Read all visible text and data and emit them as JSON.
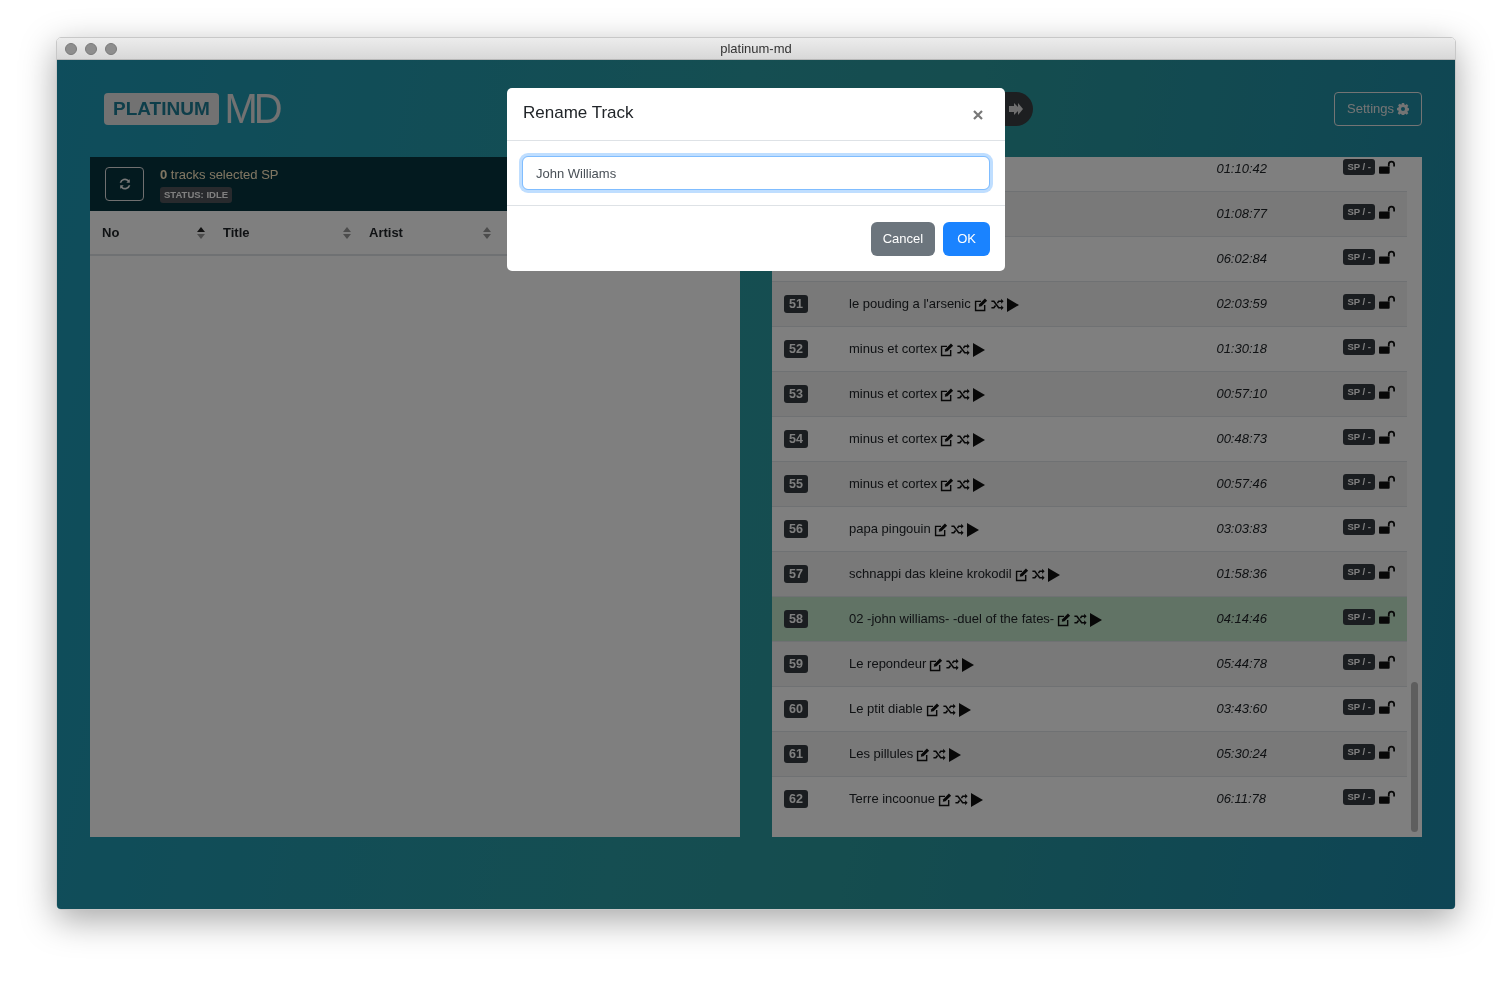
{
  "window": {
    "title": "platinum-md"
  },
  "header": {
    "logo_badge": "PLATINUM",
    "logo_text": "MD",
    "settings_button": "Settings"
  },
  "left_panel": {
    "selection_summary": "**0** tracks selected SP",
    "status_badge": "STATUS: IDLE",
    "columns": [
      {
        "label": "No",
        "sorted": true
      },
      {
        "label": "Title",
        "sorted": false
      },
      {
        "label": "Artist",
        "sorted": false
      }
    ]
  },
  "tracks": [
    {
      "duration": "01:10:42",
      "badge": "SP / -",
      "locked": false,
      "selected": false
    },
    {
      "duration": "01:08:77",
      "badge": "SP / -",
      "locked": false,
      "selected": false
    },
    {
      "duration": "06:02:84",
      "badge": "SP / -",
      "locked": false,
      "selected": false
    },
    {
      "number": "51",
      "title": "le pouding a l'arsenic",
      "duration": "02:03:59",
      "badge": "SP / -",
      "locked": false,
      "selected": false
    },
    {
      "number": "52",
      "title": "minus et cortex",
      "duration": "01:30:18",
      "badge": "SP / -",
      "locked": false,
      "selected": false
    },
    {
      "number": "53",
      "title": "minus et cortex",
      "duration": "00:57:10",
      "badge": "SP / -",
      "locked": false,
      "selected": false
    },
    {
      "number": "54",
      "title": "minus et cortex",
      "duration": "00:48:73",
      "badge": "SP / -",
      "locked": false,
      "selected": false
    },
    {
      "number": "55",
      "title": "minus et cortex",
      "duration": "00:57:46",
      "badge": "SP / -",
      "locked": false,
      "selected": false
    },
    {
      "number": "56",
      "title": "papa pingouin",
      "duration": "03:03:83",
      "badge": "SP / -",
      "locked": false,
      "selected": false
    },
    {
      "number": "57",
      "title": "schnappi das kleine krokodil",
      "duration": "01:58:36",
      "badge": "SP / -",
      "locked": false,
      "selected": false
    },
    {
      "number": "58",
      "title": "02 -john williams- -duel of the fates-",
      "duration": "04:14:46",
      "badge": "SP / -",
      "locked": false,
      "selected": true
    },
    {
      "number": "59",
      "title": "Le repondeur",
      "duration": "05:44:78",
      "badge": "SP / -",
      "locked": false,
      "selected": false
    },
    {
      "number": "60",
      "title": "Le ptit diable",
      "duration": "03:43:60",
      "badge": "SP / -",
      "locked": false,
      "selected": false
    },
    {
      "number": "61",
      "title": "Les pillules",
      "duration": "05:30:24",
      "badge": "SP / -",
      "locked": false,
      "selected": false
    },
    {
      "number": "62",
      "title": "Terre incoonue",
      "duration": "06:11:78",
      "badge": "SP / -",
      "locked": false,
      "selected": false
    }
  ],
  "modal": {
    "title": "Rename Track",
    "input_value": "John Williams",
    "buttons": [
      {
        "label": "Cancel",
        "kind": "secondary"
      },
      {
        "label": "OK",
        "kind": "primary"
      }
    ]
  }
}
